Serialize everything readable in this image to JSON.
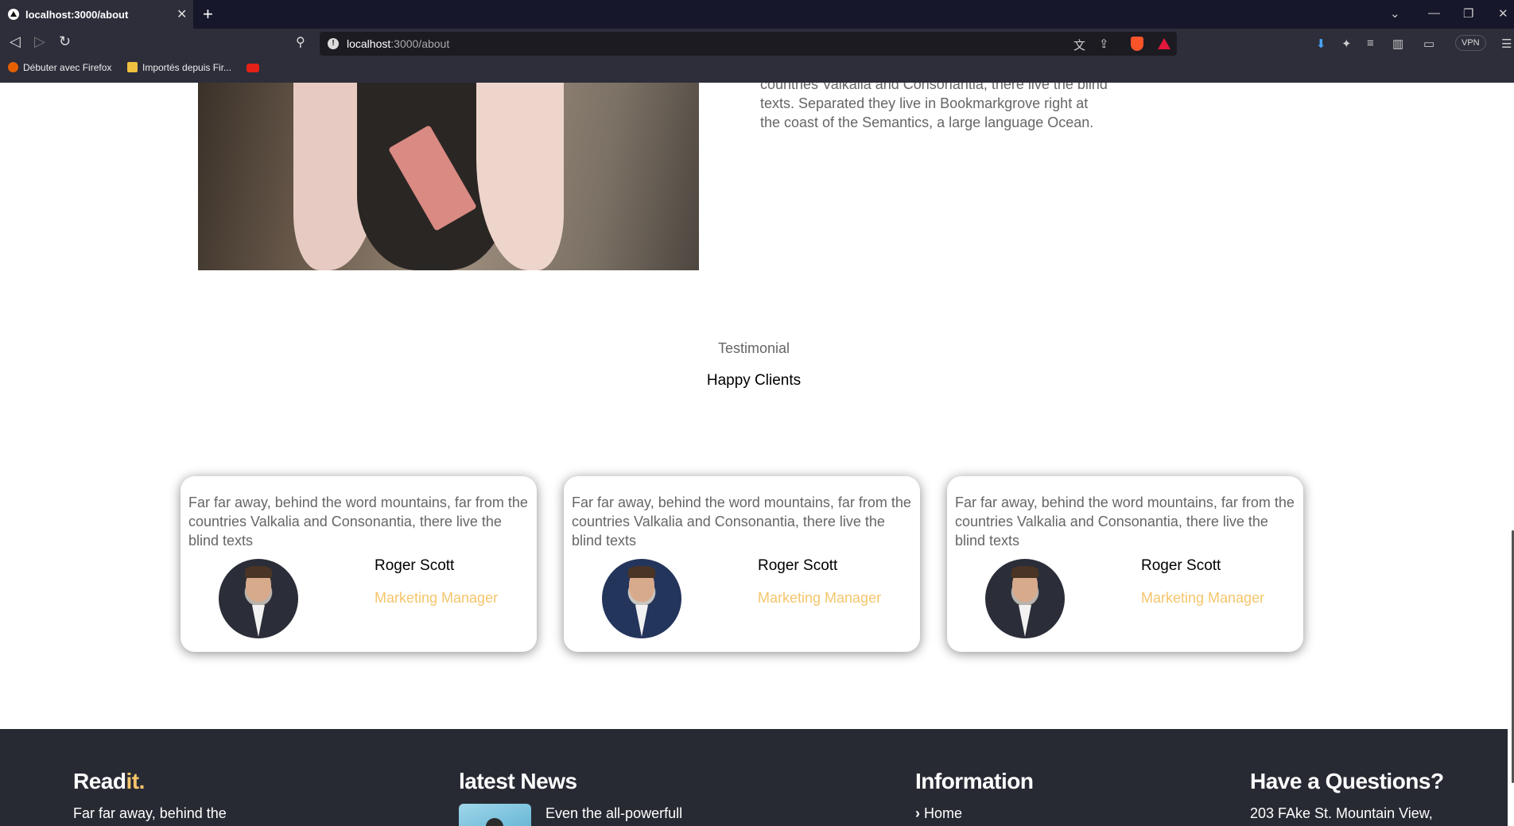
{
  "browser": {
    "tab_title": "localhost:3000/about",
    "url_host": "localhost",
    "url_path": ":3000/about",
    "vpn_label": "VPN",
    "bookmarks": [
      {
        "label": "Débuter avec Firefox"
      },
      {
        "label": "Importés depuis Fir..."
      }
    ]
  },
  "about": {
    "text": "countries Valkalia and Consonantia, there live the blind texts. Separated they live in Bookmarkgrove right at the coast of the Semantics, a large language Ocean."
  },
  "testimonial": {
    "subtitle": "Testimonial",
    "title": "Happy Clients",
    "cards": [
      {
        "quote": "Far far away, behind the word mountains, far from the countries Valkalia and Consonantia, there live the blind texts",
        "name": "Roger Scott",
        "role": "Marketing Manager"
      },
      {
        "quote": "Far far away, behind the word mountains, far from the countries Valkalia and Consonantia, there live the blind texts",
        "name": "Roger Scott",
        "role": "Marketing Manager"
      },
      {
        "quote": "Far far away, behind the word mountains, far from the countries Valkalia and Consonantia, there live the blind texts",
        "name": "Roger Scott",
        "role": "Marketing Manager"
      }
    ]
  },
  "footer": {
    "brand_main": "Read",
    "brand_accent": "it",
    "brand_dot": ".",
    "brand_text": "Far far away, behind the",
    "news_title": "latest News",
    "news_item": "Even the all-powerfull",
    "info_title": "Information",
    "info_item": "Home",
    "contact_title": "Have a Questions?",
    "contact_address": "203 FAke St. Mountain View,"
  },
  "colors": {
    "accent": "#f5c56b",
    "footer_bg": "#272a33",
    "chrome_bg": "#2d2e3a"
  }
}
